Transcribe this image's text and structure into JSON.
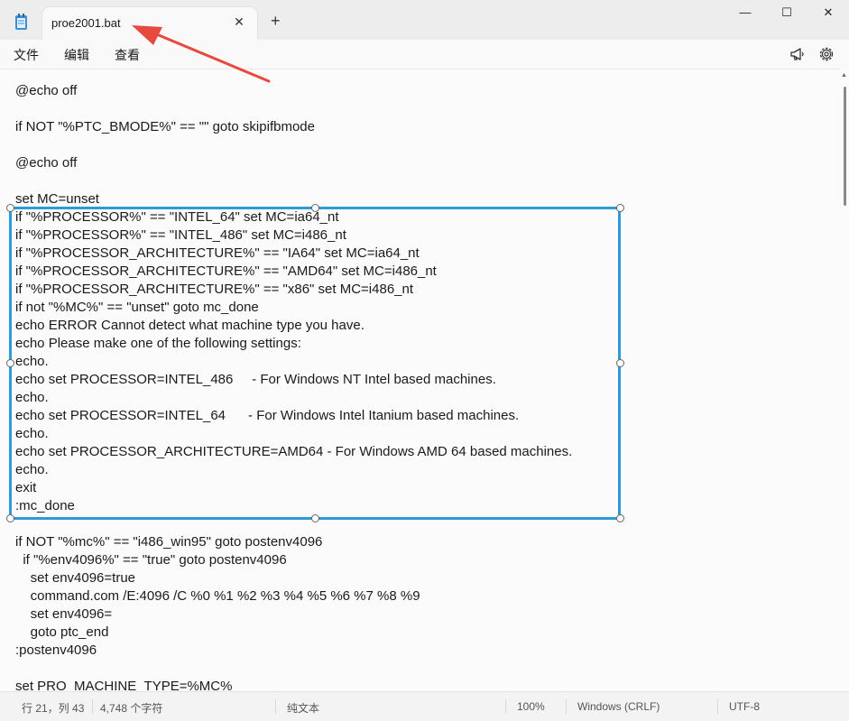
{
  "tab": {
    "title": "proe2001.bat",
    "close_glyph": "✕",
    "new_tab_glyph": "+"
  },
  "window": {
    "minimize_glyph": "—",
    "maximize_glyph": "☐",
    "close_glyph": "✕"
  },
  "menu": {
    "file": "文件",
    "edit": "编辑",
    "view": "查看"
  },
  "editor": {
    "lines": [
      "@echo off",
      "",
      "if NOT \"%PTC_BMODE%\" == \"\" goto skipifbmode",
      "",
      "@echo off",
      "",
      "set MC=unset",
      "if \"%PROCESSOR%\" == \"INTEL_64\" set MC=ia64_nt",
      "if \"%PROCESSOR%\" == \"INTEL_486\" set MC=i486_nt",
      "if \"%PROCESSOR_ARCHITECTURE%\" == \"IA64\" set MC=ia64_nt",
      "if \"%PROCESSOR_ARCHITECTURE%\" == \"AMD64\" set MC=i486_nt",
      "if \"%PROCESSOR_ARCHITECTURE%\" == \"x86\" set MC=i486_nt",
      "if not \"%MC%\" == \"unset\" goto mc_done",
      "echo ERROR Cannot detect what machine type you have.",
      "echo Please make one of the following settings:",
      "echo.",
      "echo set PROCESSOR=INTEL_486     - For Windows NT Intel based machines.",
      "echo.",
      "echo set PROCESSOR=INTEL_64      - For Windows Intel Itanium based machines.",
      "echo.",
      "echo set PROCESSOR_ARCHITECTURE=AMD64 - For Windows AMD 64 based machines.",
      "echo.",
      "exit",
      ":mc_done",
      "",
      "if NOT \"%mc%\" == \"i486_win95\" goto postenv4096",
      "  if \"%env4096%\" == \"true\" goto postenv4096",
      "    set env4096=true",
      "    command.com /E:4096 /C %0 %1 %2 %3 %4 %5 %6 %7 %8 %9",
      "    set env4096=",
      "    goto ptc_end",
      ":postenv4096",
      "",
      "set PRO_MACHINE_TYPE=%MC%"
    ]
  },
  "status": {
    "position": "行 21，列 43",
    "char_count": "4,748 个字符",
    "format": "纯文本",
    "zoom": "100%",
    "line_ending": "Windows (CRLF)",
    "encoding": "UTF-8"
  },
  "colors": {
    "selection_border": "#2d9bd6",
    "arrow": "#e8493f"
  }
}
